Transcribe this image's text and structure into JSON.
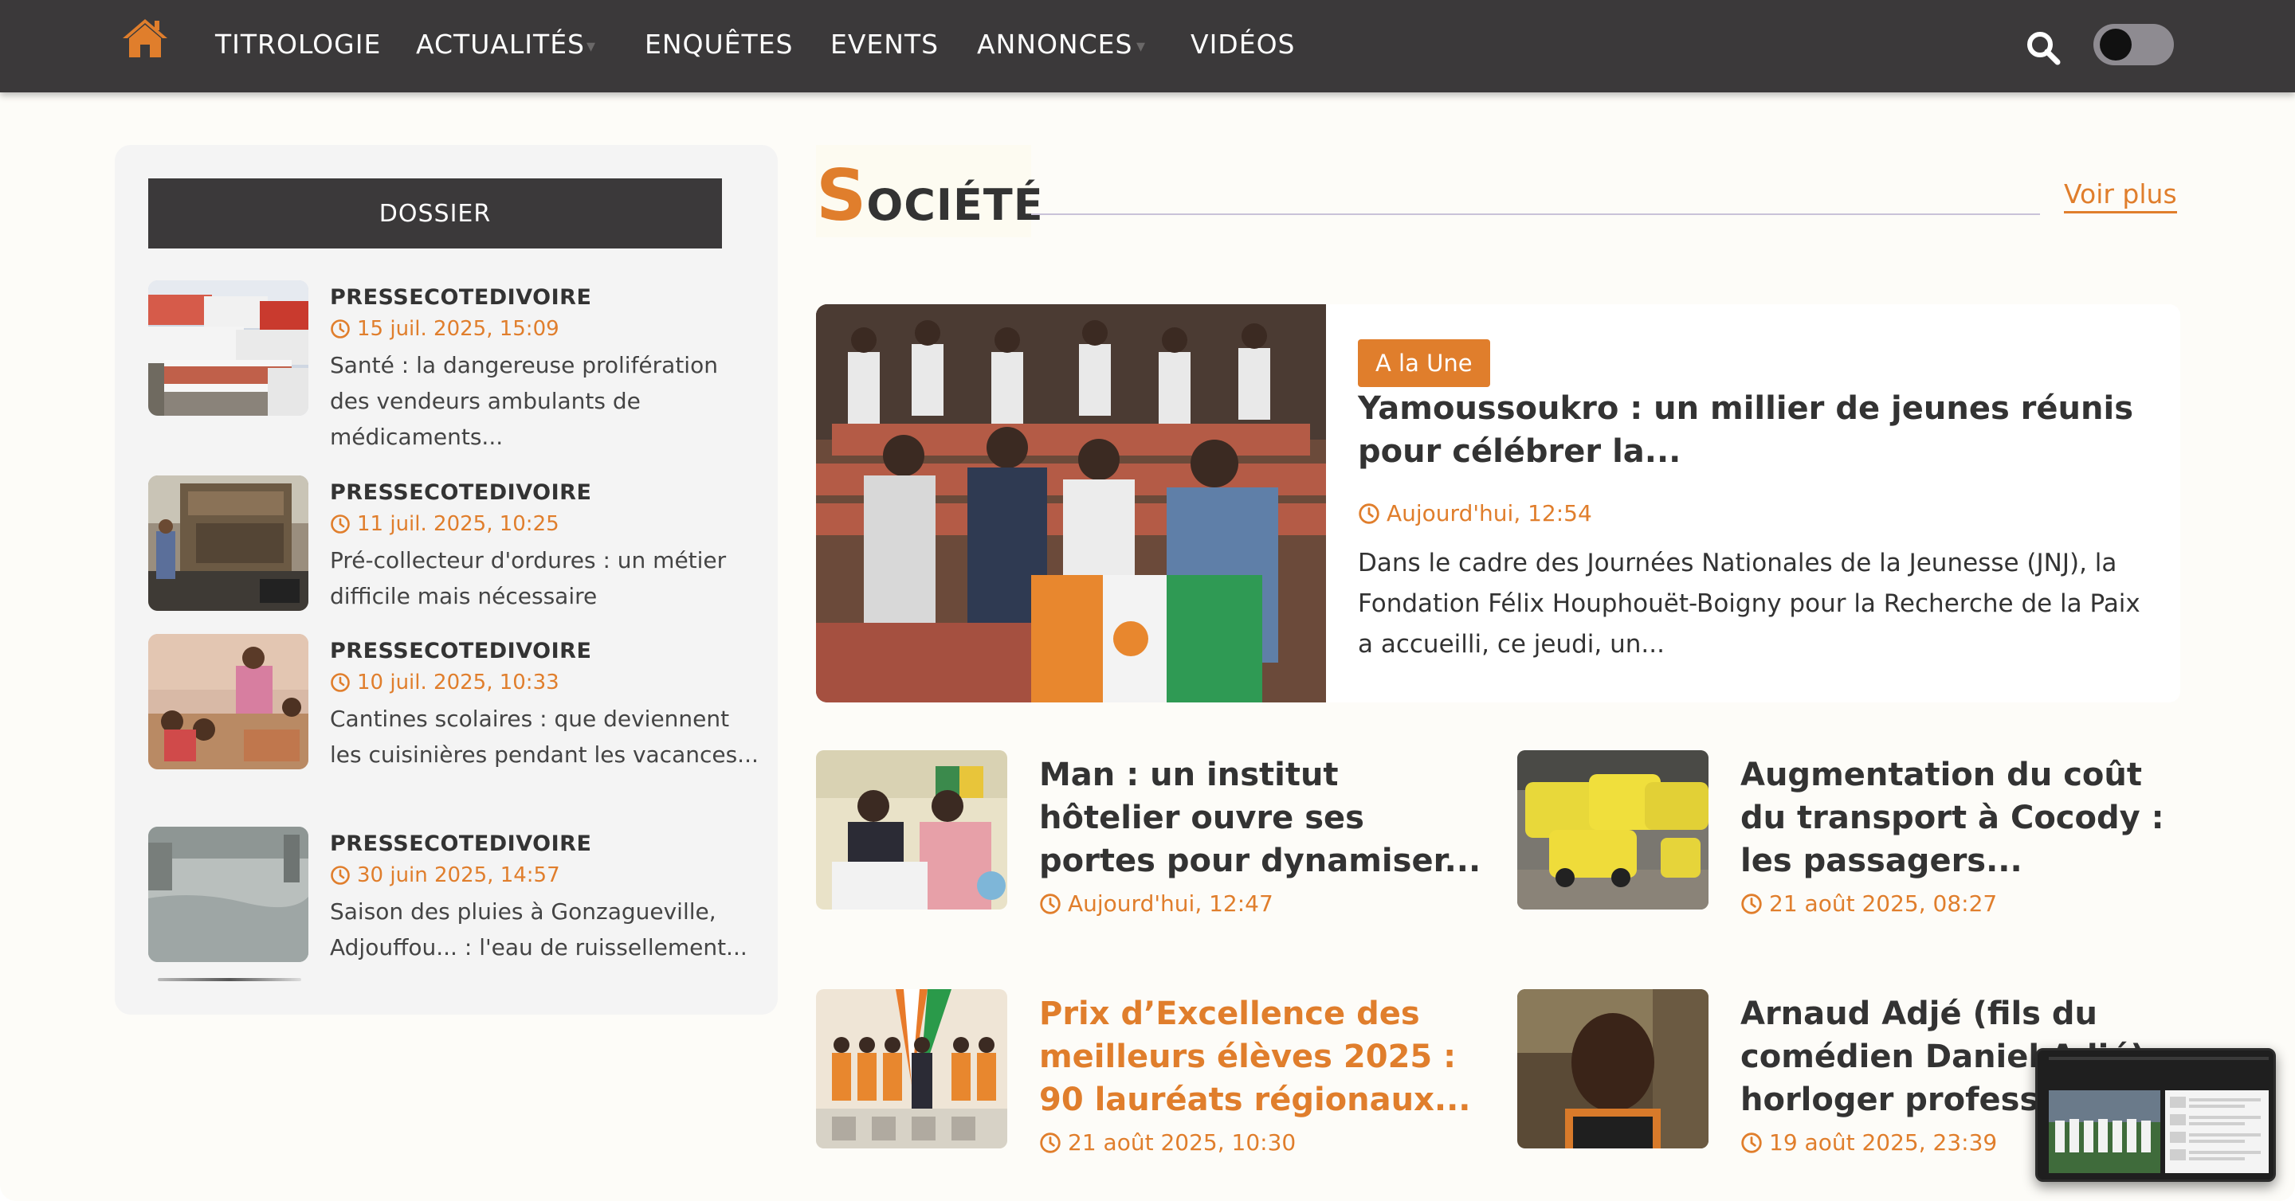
{
  "nav": {
    "items": [
      {
        "label": "TITROLOGIE"
      },
      {
        "label": "ACTUALITÉS"
      },
      {
        "label": "ENQUÊTES"
      },
      {
        "label": "EVENTS"
      },
      {
        "label": "ANNONCES"
      },
      {
        "label": "VIDÉOS"
      }
    ],
    "dark_mode_on": false
  },
  "sidebar": {
    "heading": "DOSSIER",
    "items": [
      {
        "source": "PRESSECOTEDIVOIRE",
        "date": "15 juil. 2025, 15:09",
        "text": "Santé : la dangereuse prolifération des vendeurs ambulants de médicaments..."
      },
      {
        "source": "PRESSECOTEDIVOIRE",
        "date": "11 juil. 2025, 10:25",
        "text": "Pré-collecteur d'ordures : un métier difficile mais nécessaire"
      },
      {
        "source": "PRESSECOTEDIVOIRE",
        "date": "10 juil. 2025, 10:33",
        "text": "Cantines scolaires : que deviennent les cuisinières pendant les vacances..."
      },
      {
        "source": "PRESSECOTEDIVOIRE",
        "date": "30 juin 2025, 14:57",
        "text": "Saison des pluies à Gonzagueville, Adjouffou... : l'eau de ruissellement..."
      }
    ]
  },
  "section": {
    "title_initial": "S",
    "title_rest": "OCIÉTÉ",
    "more_label": "Voir plus"
  },
  "featured": {
    "badge": "A la Une",
    "title": "Yamoussoukro : un millier de jeunes réunis pour célébrer la...",
    "date": "Aujourd'hui, 12:54",
    "text": "Dans le cadre des Journées Nationales de la Jeunesse (JNJ), la Fondation Félix Houphouët-Boigny pour la Recherche de la Paix a accueilli, ce jeudi, un..."
  },
  "cards": [
    {
      "title": "Man : un institut hôtelier ouvre ses portes pour dynamiser...",
      "date": "Aujourd'hui, 12:47"
    },
    {
      "title": "Augmentation du coût du transport à Cocody : les passagers...",
      "date": "21 août 2025, 08:27"
    },
    {
      "title": "Prix d’Excellence des meilleurs élèves 2025 : 90 lauréats régionaux...",
      "date": "21 août 2025, 10:30"
    },
    {
      "title": "Arnaud Adjé (fils du comédien Daniel Adjé), horloger professionnel...",
      "date": "19 août 2025, 23:39"
    }
  ],
  "colors": {
    "accent": "#e07e2c",
    "navbar": "#3b393a",
    "page_bg": "#fdfcf8",
    "sidebar_bg": "#f4f4f4"
  },
  "icons": [
    "home-icon",
    "search-icon",
    "clock-icon",
    "dark-mode-toggle"
  ]
}
